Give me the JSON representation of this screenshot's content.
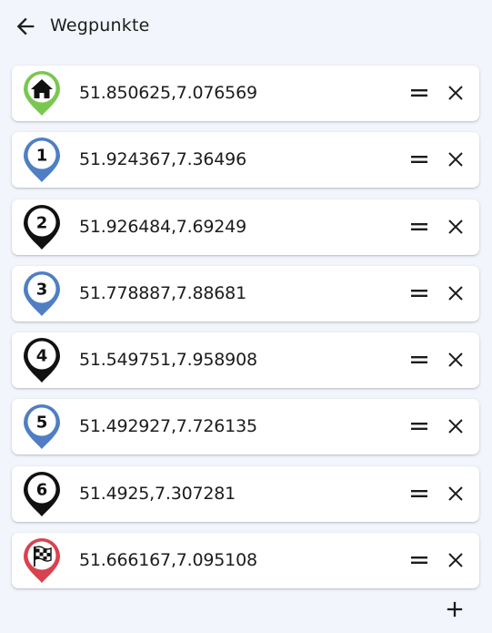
{
  "header": {
    "title": "Wegpunkte",
    "back_icon": "arrow-left-icon"
  },
  "colors": {
    "background": "#f2f5fc",
    "green": "#7ac74f",
    "blue": "#4f7ec4",
    "black": "#111111",
    "red": "#d9414e"
  },
  "waypoints": [
    {
      "marker": "home",
      "color": "green",
      "coords": "51.850625,7.076569"
    },
    {
      "marker": "1",
      "color": "blue",
      "coords": "51.924367,7.36496"
    },
    {
      "marker": "2",
      "color": "black",
      "coords": "51.926484,7.69249"
    },
    {
      "marker": "3",
      "color": "blue",
      "coords": "51.778887,7.88681"
    },
    {
      "marker": "4",
      "color": "black",
      "coords": "51.549751,7.958908"
    },
    {
      "marker": "5",
      "color": "blue",
      "coords": "51.492927,7.726135"
    },
    {
      "marker": "6",
      "color": "black",
      "coords": "51.4925,7.307281"
    },
    {
      "marker": "finish",
      "color": "red",
      "coords": "51.666167,7.095108"
    }
  ],
  "actions": {
    "drag_icon": "drag-handle-icon",
    "remove_icon": "close-icon",
    "add_icon": "plus-icon"
  }
}
